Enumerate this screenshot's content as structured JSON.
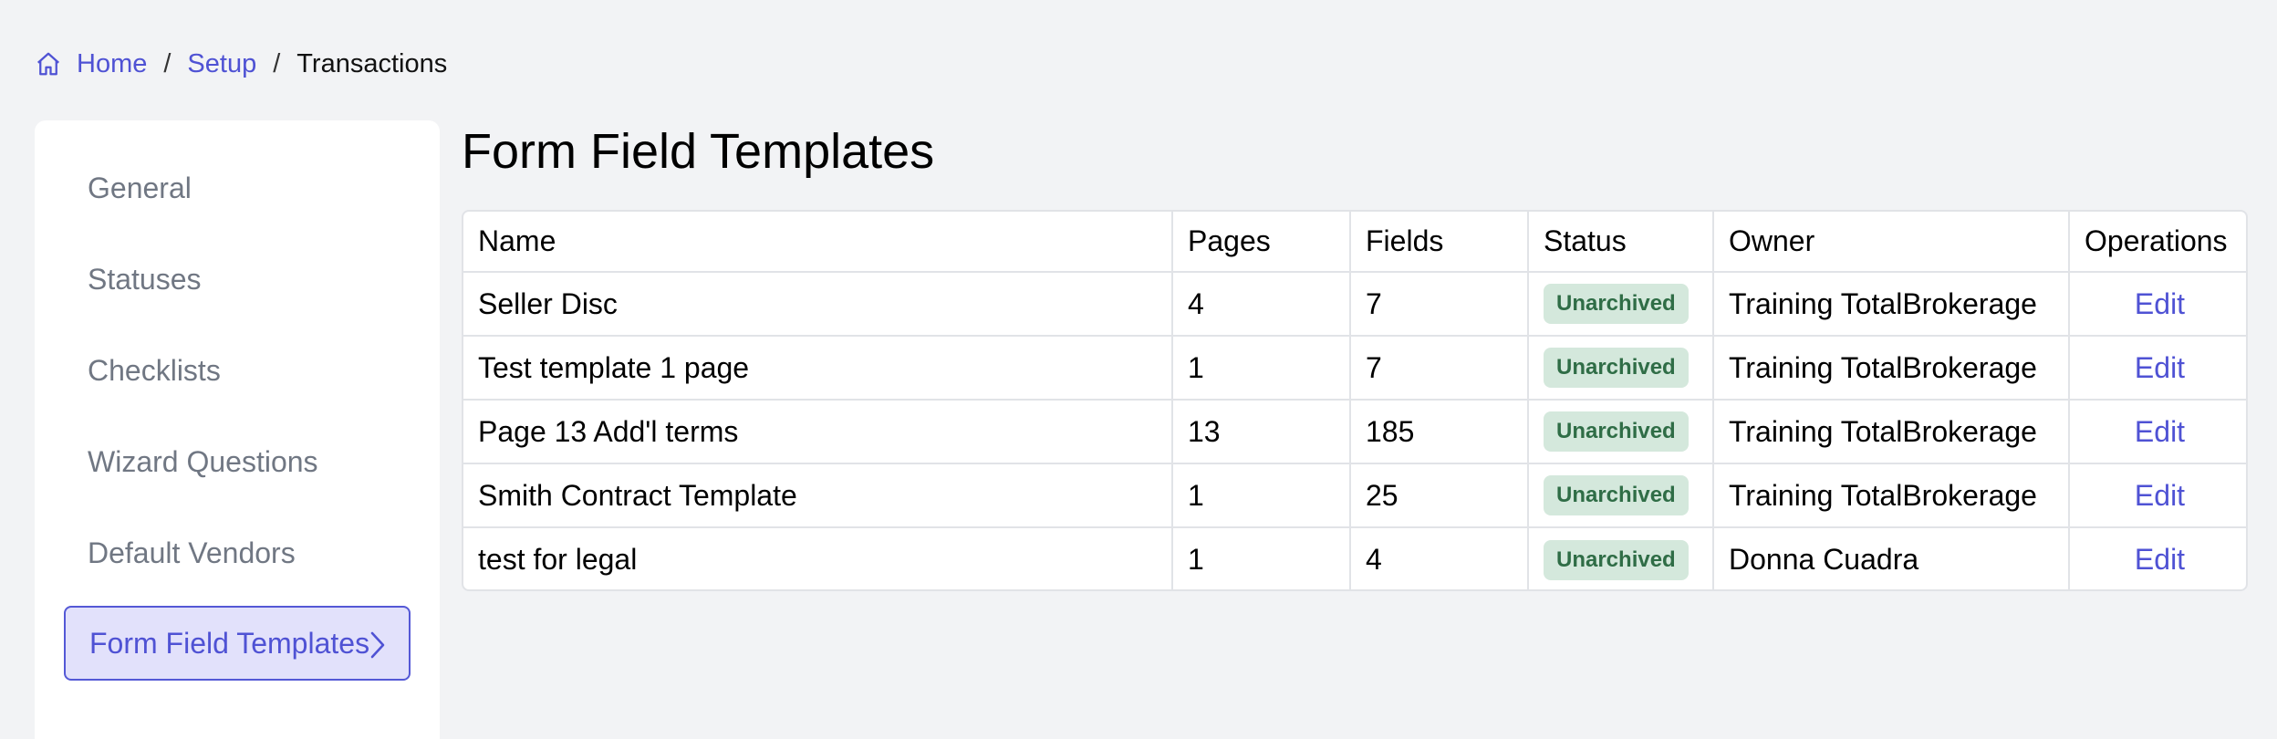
{
  "breadcrumb": {
    "home": "Home",
    "setup": "Setup",
    "current": "Transactions",
    "separator": "/"
  },
  "sidebar": {
    "items": [
      {
        "label": "General"
      },
      {
        "label": "Statuses"
      },
      {
        "label": "Checklists"
      },
      {
        "label": "Wizard Questions"
      },
      {
        "label": "Default Vendors"
      },
      {
        "label": "Form Field Templates",
        "active": true
      }
    ]
  },
  "page": {
    "title": "Form Field Templates"
  },
  "table": {
    "columns": [
      "Name",
      "Pages",
      "Fields",
      "Status",
      "Owner",
      "Operations"
    ],
    "rows": [
      {
        "name": "Seller Disc",
        "pages": "4",
        "fields": "7",
        "status": "Unarchived",
        "owner": "Training TotalBrokerage",
        "op": "Edit"
      },
      {
        "name": "Test template 1 page",
        "pages": "1",
        "fields": "7",
        "status": "Unarchived",
        "owner": "Training TotalBrokerage",
        "op": "Edit"
      },
      {
        "name": "Page 13 Add'l terms",
        "pages": "13",
        "fields": "185",
        "status": "Unarchived",
        "owner": "Training TotalBrokerage",
        "op": "Edit"
      },
      {
        "name": "Smith Contract Template",
        "pages": "1",
        "fields": "25",
        "status": "Unarchived",
        "owner": "Training TotalBrokerage",
        "op": "Edit"
      },
      {
        "name": "test for legal",
        "pages": "1",
        "fields": "4",
        "status": "Unarchived",
        "owner": "Donna Cuadra",
        "op": "Edit"
      }
    ]
  },
  "colors": {
    "accent": "#4f52d4",
    "active_bg": "#e2e1fb",
    "badge_bg": "#d4e8dc",
    "badge_text": "#2f6d46",
    "page_bg": "#f2f3f5"
  },
  "icons": {
    "home": "home-icon",
    "chevron": "chevron-right-icon"
  }
}
